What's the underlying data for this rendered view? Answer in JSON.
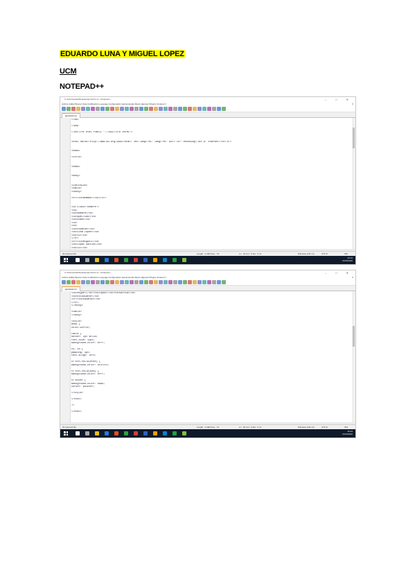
{
  "header": {
    "names": "EDUARDO LUNA Y MIGUEL LOPEZ",
    "institution": "UCM",
    "title": "NOTEPAD++"
  },
  "screenshots": [
    {
      "tab_label": "ejercicio1.txt",
      "lines": [
        {
          "n": "1",
          "t": "<?xml"
        },
        {
          "n": "2",
          "t": ""
        },
        {
          "n": "3",
          "t": "<?php"
        },
        {
          "n": "4",
          "t": ""
        },
        {
          "n": "5",
          "t": "<!DOCTYPE html PUBLIC \"-//W3C//DTD XHTML\">"
        },
        {
          "n": "6",
          "t": ""
        },
        {
          "n": "7",
          "t": ""
        },
        {
          "n": "8",
          "t": "<html xmlns=\"http://www.w3.org/1999/xhtml\" xml:lang=\"es\" lang=\"es\" dir=\"ltr\" encoding=\"utf-8\" charset=\"utf-8\">"
        },
        {
          "n": "9",
          "t": ""
        },
        {
          "n": "10",
          "t": ""
        },
        {
          "n": "11",
          "t": "<head>"
        },
        {
          "n": "12",
          "t": ""
        },
        {
          "n": "13",
          "t": "<title>"
        },
        {
          "n": "14",
          "t": ""
        },
        {
          "n": "15",
          "t": ""
        },
        {
          "n": "16",
          "t": "<head>"
        },
        {
          "n": "17",
          "t": ""
        },
        {
          "n": "18",
          "t": ""
        },
        {
          "n": "19",
          "t": "<body>"
        },
        {
          "n": "20",
          "t": ""
        },
        {
          "n": "21",
          "t": ""
        },
        {
          "n": "22",
          "t": "<CONTENIDO>"
        },
        {
          "n": "23",
          "t": "<table>"
        },
        {
          "n": "24",
          "t": "<tbody>"
        },
        {
          "n": "25",
          "t": ""
        },
        {
          "n": "26",
          "t": "<tr><td>NOMBRE</td></tr>"
        },
        {
          "n": "27",
          "t": ""
        },
        {
          "n": "28",
          "t": ""
        },
        {
          "n": "29",
          "t": "<td class=\"nombre\">"
        },
        {
          "n": "30",
          "t": "<td>"
        },
        {
          "n": "31",
          "t": "<td>Nombre</td>"
        },
        {
          "n": "32",
          "t": "<td>Apellido</td>"
        },
        {
          "n": "33",
          "t": "<td>Edad</td>"
        },
        {
          "n": "34",
          "t": "<td>"
        },
        {
          "n": "35",
          "t": "<td>"
        },
        {
          "n": "36",
          "t": "<td>Eduardo</td>"
        },
        {
          "n": "37",
          "t": "<td>Luna Lopez</td>"
        },
        {
          "n": "38",
          "t": "<td>22</td>"
        },
        {
          "n": "39",
          "t": "</tr>"
        },
        {
          "n": "40",
          "t": "<tr><td>Miguel</td>"
        },
        {
          "n": "41",
          "t": "<td>Lopez Garcia</td>"
        },
        {
          "n": "42",
          "t": "<td>23</td>"
        }
      ],
      "status": {
        "type": "Length : 2,400  lines : 74",
        "pos": "Ln : 42  Col : 9  Sel : 0 | 0",
        "eol": "Windows (CR LF)",
        "enc": "UTF-8",
        "mode": "INS"
      },
      "tray_time": "20:23",
      "tray_date": "21/03/2020"
    },
    {
      "tab_label": "ejercicio1.txt",
      "lines": [
        {
          "n": "43",
          "t": "<td>Miguel</td><td>Lopez</td><td>Garcia</td>"
        },
        {
          "n": "44",
          "t": "<td>Estudiante</td>"
        },
        {
          "n": "45",
          "t": "<tr><td>Eduardo</td>"
        },
        {
          "n": "46",
          "t": "</tr>"
        },
        {
          "n": "47",
          "t": "</tbody>"
        },
        {
          "n": "48",
          "t": ""
        },
        {
          "n": "49",
          "t": "<table>"
        },
        {
          "n": "50",
          "t": "</body>"
        },
        {
          "n": "51",
          "t": ""
        },
        {
          "n": "52",
          "t": "<style>"
        },
        {
          "n": "53",
          "t": "body {"
        },
        {
          "n": "54",
          "t": "color:#2ff2c;"
        },
        {
          "n": "55",
          "t": ""
        },
        {
          "n": "56",
          "t": "table {"
        },
        {
          "n": "57",
          "t": "border: 1px solid;"
        },
        {
          "n": "58",
          "t": "font-size: 12px;"
        },
        {
          "n": "59",
          "t": "background-color: #fff;"
        },
        {
          "n": "60",
          "t": ""
        },
        {
          "n": "61",
          "t": "th, td {"
        },
        {
          "n": "62",
          "t": "padding: 5px;"
        },
        {
          "n": "63",
          "t": "text-align: left;"
        },
        {
          "n": "64",
          "t": ""
        },
        {
          "n": "65",
          "t": "tr:nth-child(even) {"
        },
        {
          "n": "66",
          "t": "background-color: #f2f2f2;"
        },
        {
          "n": "67",
          "t": ""
        },
        {
          "n": "68",
          "t": "tr:nth-child(odd) {"
        },
        {
          "n": "69",
          "t": "background-color: #fff;"
        },
        {
          "n": "70",
          "t": ""
        },
        {
          "n": "71",
          "t": "tr:hover {"
        },
        {
          "n": "72",
          "t": "background-color: #ddd;"
        },
        {
          "n": "73",
          "t": "cursor: pointer;"
        },
        {
          "n": "74",
          "t": ""
        },
        {
          "n": "75",
          "t": "</style>"
        },
        {
          "n": "76",
          "t": ""
        },
        {
          "n": "77",
          "t": "</html>"
        },
        {
          "n": "78",
          "t": ""
        },
        {
          "n": "79",
          "t": "?>"
        },
        {
          "n": "80",
          "t": ""
        },
        {
          "n": "81",
          "t": "</html>"
        }
      ],
      "status": {
        "type": "Length : 2,400  lines : 74",
        "pos": "Ln : 81  Col : 9  Sel : 0 | 0",
        "eol": "Windows (CR LF)",
        "enc": "UTF-8",
        "mode": "INS"
      },
      "tray_time": "20:23",
      "tray_date": "21/03/2020"
    }
  ],
  "common": {
    "window_title": "C:\\Users\\eduar\\Desktop\\ejercicio1.txt - Notepad++",
    "menu": "Archivo  Editar  Buscar  Vista  Codificación  Lenguaje  Configuración  Herramientas  Macro  Ejecutar  Plugins  Ventana  ?",
    "window_controls": "– □ ✕",
    "menu_close": "X",
    "statusbar_left": "Normal text file",
    "colors": {
      "highlight": "#ffff00",
      "taskbar": "#0f1b2a",
      "tab_accent": "#f0a030"
    }
  }
}
